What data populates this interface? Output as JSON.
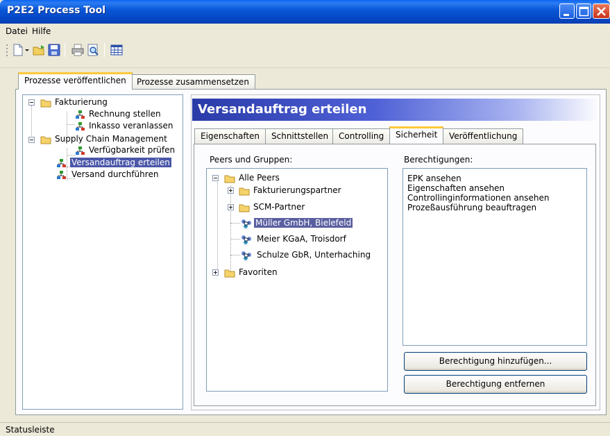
{
  "window": {
    "title": "P2E2 Process Tool"
  },
  "menu": {
    "items": [
      "Datei",
      "Hilfe"
    ]
  },
  "toolbar": {
    "icons": [
      "new-document-icon",
      "dropdown-arrow-icon",
      "open-folder-icon",
      "save-icon",
      "print-icon",
      "print-preview-icon",
      "grid-view-icon"
    ]
  },
  "outer_tabs": [
    "Prozesse veröffentlichen",
    "Prozesse zusammensetzen"
  ],
  "process_tree": {
    "groups": [
      {
        "label": "Fakturierung",
        "children": [
          "Rechnung stellen",
          "Inkasso veranlassen"
        ]
      },
      {
        "label": "Supply Chain Management",
        "children": [
          "Verfügbarkeit prüfen",
          "Versandauftrag erteilen",
          "Versand durchführen"
        ]
      }
    ],
    "selected": "Versandauftrag erteilen"
  },
  "detail": {
    "title": "Versandauftrag erteilen",
    "tabs": [
      "Eigenschaften",
      "Schnittstellen",
      "Controlling",
      "Sicherheit",
      "Veröffentlichung"
    ],
    "active_tab": "Sicherheit"
  },
  "peers": {
    "heading": "Peers und Gruppen:",
    "root": "Alle Peers",
    "groups": [
      "Fakturierungspartner",
      "SCM-Partner"
    ],
    "members": [
      "Müller GmbH, Bielefeld",
      "Meier KGaA, Troisdorf",
      "Schulze GbR, Unterhaching"
    ],
    "favorites": "Favoriten",
    "selected": "Müller GmbH, Bielefeld"
  },
  "permissions": {
    "heading": "Berechtigungen:",
    "items": [
      "EPK ansehen",
      "Eigenschaften ansehen",
      "Controllinginformationen ansehen",
      "Prozeßausführung beauftragen"
    ],
    "add_button": "Berechtigung hinzufügen...",
    "remove_button": "Berechtigung entfernen"
  },
  "status": {
    "text": "Statusleiste"
  },
  "colors": {
    "titlebar": "#0a58d8",
    "selection": "#4b57a8",
    "tab_highlight": "#ffc83c",
    "banner": "#2a3ba8"
  }
}
